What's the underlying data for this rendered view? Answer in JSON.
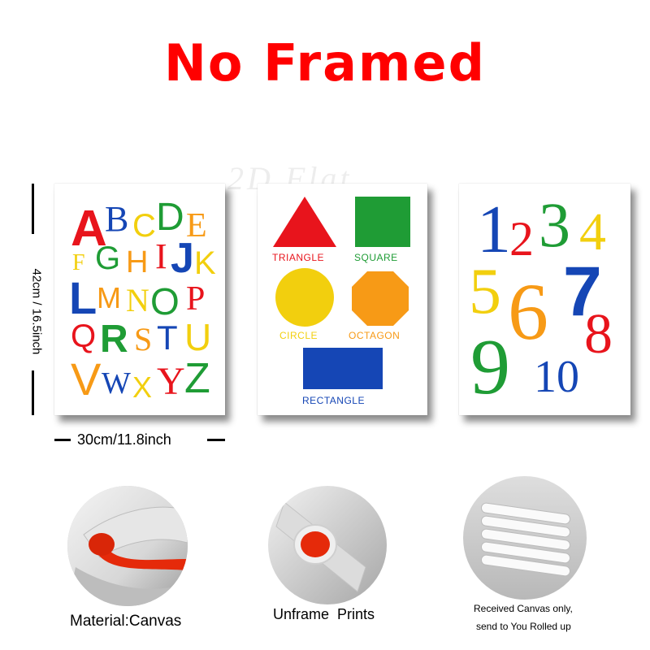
{
  "headline": "No Framed",
  "watermark": "2D Flat",
  "dimensions": {
    "height": "42cm / 16.5inch",
    "width": "30cm/11.8inch"
  },
  "colors": {
    "red": "#e8141c",
    "blue": "#1546b5",
    "green": "#1f9c35",
    "yellow": "#f2cf0e",
    "orange": "#f79a16",
    "canvas_backing": "#e52a0a"
  },
  "alphabet": {
    "letters": [
      "A",
      "B",
      "C",
      "D",
      "E",
      "F",
      "G",
      "H",
      "I",
      "J",
      "K",
      "L",
      "M",
      "N",
      "O",
      "P",
      "Q",
      "R",
      "S",
      "T",
      "U",
      "V",
      "W",
      "X",
      "Y",
      "Z"
    ]
  },
  "shapes": [
    {
      "label": "TRIANGLE",
      "color": "#e8141c"
    },
    {
      "label": "SQUARE",
      "color": "#1f9c35"
    },
    {
      "label": "CIRCLE",
      "color": "#f2cf0e"
    },
    {
      "label": "OCTAGON",
      "color": "#f79a16"
    },
    {
      "label": "RECTANGLE",
      "color": "#1546b5"
    }
  ],
  "numbers": [
    "1",
    "2",
    "3",
    "4",
    "5",
    "6",
    "7",
    "8",
    "9",
    "10"
  ],
  "features": [
    {
      "icon": "rolled-canvas-photo",
      "caption": "Material:Canvas"
    },
    {
      "icon": "canvas-roll-photo",
      "caption": "Unframe  Prints"
    },
    {
      "icon": "rolled-packages-photo",
      "caption_line1": "Received Canvas only,",
      "caption_line2": "send to You Rolled up"
    }
  ]
}
